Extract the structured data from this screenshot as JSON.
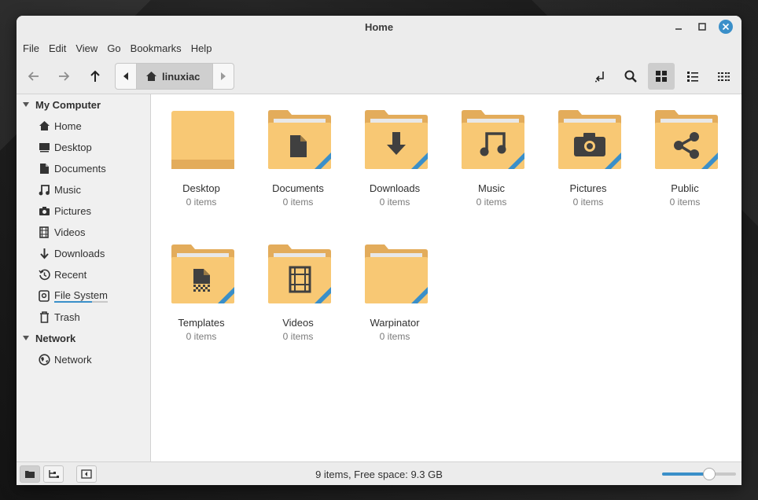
{
  "window": {
    "title": "Home"
  },
  "menu": [
    "File",
    "Edit",
    "View",
    "Go",
    "Bookmarks",
    "Help"
  ],
  "toolbar": {
    "path": [
      "linuxiac"
    ]
  },
  "sidebar": {
    "sections": [
      {
        "title": "My Computer",
        "items": [
          {
            "label": "Home",
            "icon": "home-icon"
          },
          {
            "label": "Desktop",
            "icon": "desktop-icon"
          },
          {
            "label": "Documents",
            "icon": "document-icon"
          },
          {
            "label": "Music",
            "icon": "music-icon"
          },
          {
            "label": "Pictures",
            "icon": "camera-icon"
          },
          {
            "label": "Videos",
            "icon": "film-icon"
          },
          {
            "label": "Downloads",
            "icon": "download-icon"
          },
          {
            "label": "Recent",
            "icon": "history-icon"
          },
          {
            "label": "File System",
            "icon": "drive-icon",
            "usage_fraction": 0.7
          },
          {
            "label": "Trash",
            "icon": "trash-icon"
          }
        ]
      },
      {
        "title": "Network",
        "items": [
          {
            "label": "Network",
            "icon": "globe-icon"
          }
        ]
      }
    ]
  },
  "files": [
    {
      "name": "Desktop",
      "meta": "0 items",
      "emblem": "none"
    },
    {
      "name": "Documents",
      "meta": "0 items",
      "emblem": "document-icon"
    },
    {
      "name": "Downloads",
      "meta": "0 items",
      "emblem": "download-icon"
    },
    {
      "name": "Music",
      "meta": "0 items",
      "emblem": "music-icon"
    },
    {
      "name": "Pictures",
      "meta": "0 items",
      "emblem": "camera-icon"
    },
    {
      "name": "Public",
      "meta": "0 items",
      "emblem": "share-icon"
    },
    {
      "name": "Templates",
      "meta": "0 items",
      "emblem": "template-icon"
    },
    {
      "name": "Videos",
      "meta": "0 items",
      "emblem": "film-icon"
    },
    {
      "name": "Warpinator",
      "meta": "0 items",
      "emblem": "none"
    }
  ],
  "status": {
    "text": "9 items, Free space: 9.3 GB",
    "zoom_level": 0.64
  },
  "colors": {
    "accent": "#3a8fc9",
    "close_button": "#3a8fc9",
    "folder_front": "#f8c874",
    "folder_back": "#e3ac5b",
    "emblem": "#404040"
  }
}
